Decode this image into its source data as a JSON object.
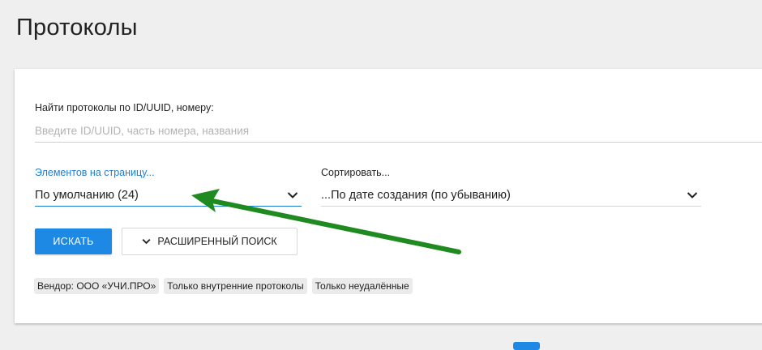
{
  "page": {
    "title": "Протоколы"
  },
  "search": {
    "label": "Найти протоколы по ID/UUID, номеру:",
    "placeholder": "Введите ID/UUID, часть номера, названия",
    "value": ""
  },
  "per_page": {
    "label": "Элементов на страницу...",
    "value": "По умолчанию (24)"
  },
  "sort": {
    "label": "Сортировать...",
    "value": "...По дате создания (по убыванию)"
  },
  "buttons": {
    "search": "ИСКАТЬ",
    "advanced": "РАСШИРЕННЫЙ ПОИСК"
  },
  "filters": [
    "Вендор: ООО «УЧИ.ПРО»",
    "Только внутренние протоколы",
    "Только неудалённые"
  ],
  "colors": {
    "accent": "#1e88e5",
    "annotation_arrow": "#1f8a1f"
  },
  "icons": {
    "dropdown": "chevron-down-icon",
    "annotation": "arrow-icon"
  }
}
